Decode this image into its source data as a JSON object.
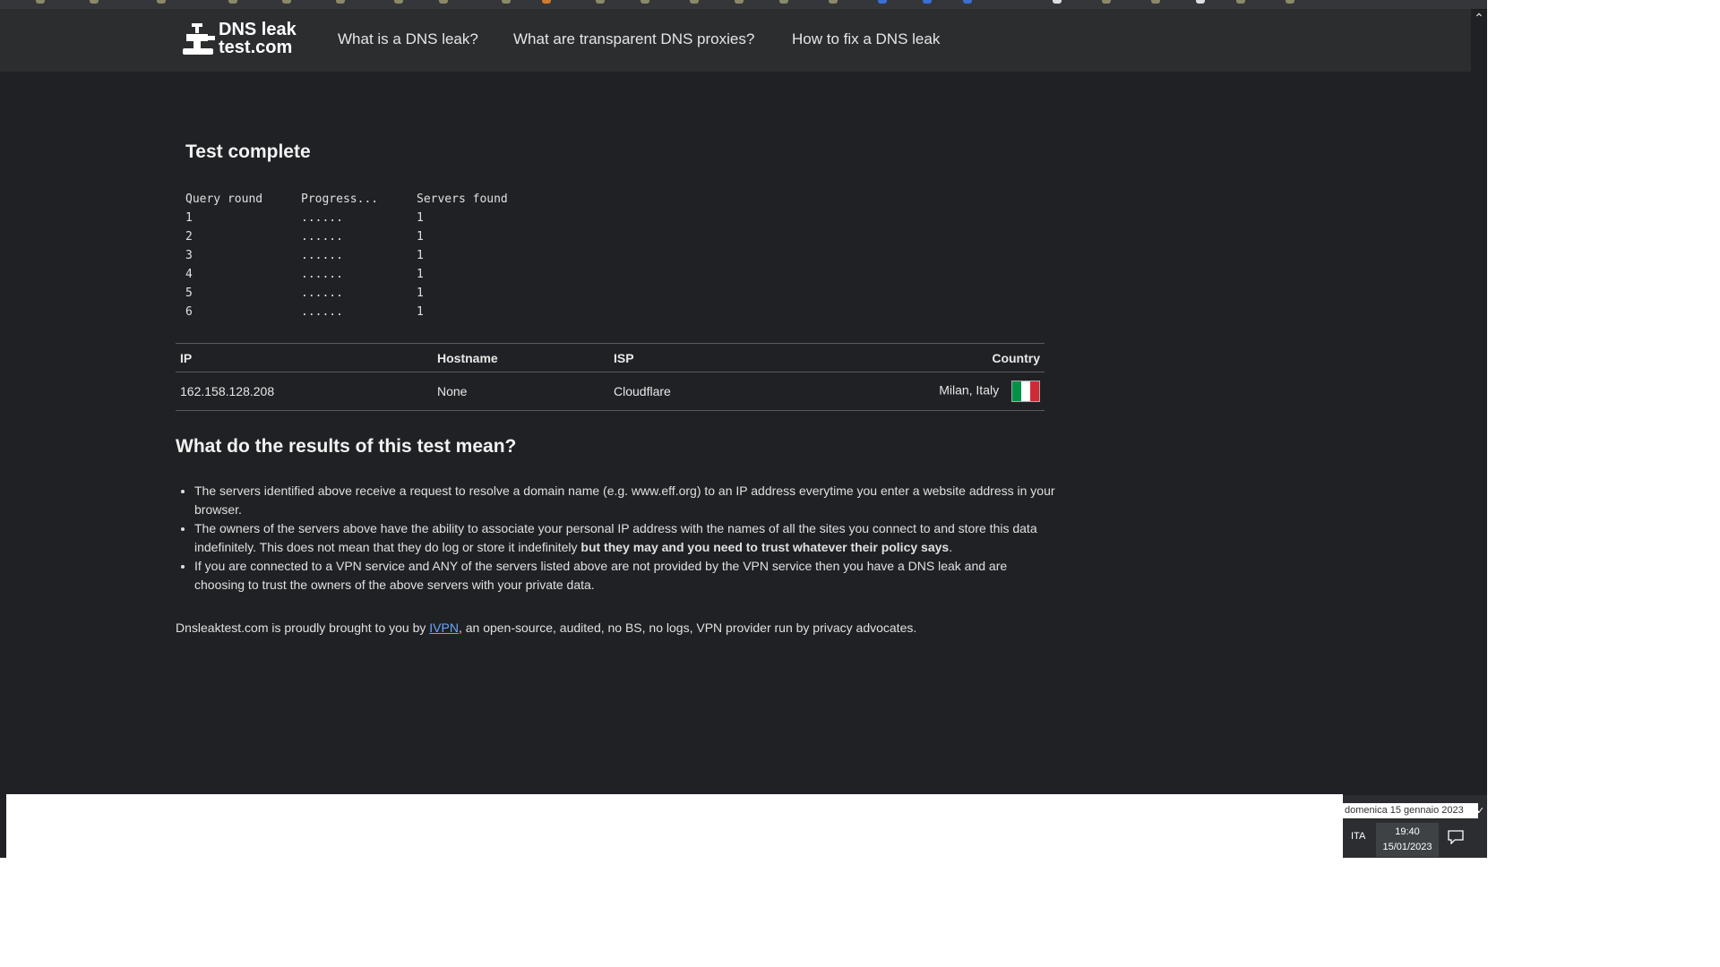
{
  "nav": {
    "logo_text_line1": "DNS leak",
    "logo_text_line2": "test.com",
    "links": [
      "What is a DNS leak?",
      "What are transparent DNS proxies?",
      "How to fix a DNS leak"
    ]
  },
  "test": {
    "title": "Test complete",
    "headers": [
      "Query round",
      "Progress...",
      "Servers found"
    ],
    "rounds": [
      {
        "round": "1",
        "progress": "......",
        "found": "1"
      },
      {
        "round": "2",
        "progress": "......",
        "found": "1"
      },
      {
        "round": "3",
        "progress": "......",
        "found": "1"
      },
      {
        "round": "4",
        "progress": "......",
        "found": "1"
      },
      {
        "round": "5",
        "progress": "......",
        "found": "1"
      },
      {
        "round": "6",
        "progress": "......",
        "found": "1"
      }
    ]
  },
  "results": {
    "headers": {
      "ip": "IP",
      "hostname": "Hostname",
      "isp": "ISP",
      "country": "Country"
    },
    "row": {
      "ip": "162.158.128.208",
      "hostname": "None",
      "isp": "Cloudflare",
      "country": "Milan, Italy",
      "flag_colors": [
        "#009246",
        "#ffffff",
        "#ce2b37"
      ]
    }
  },
  "explain": {
    "title": "What do the results of this test mean?",
    "bullet1": "The servers identified above receive a request to resolve a domain name (e.g. www.eff.org) to an IP address everytime you enter a website address in your browser.",
    "bullet2_pre": "The owners of the servers above have the ability to associate your personal IP address with the names of all the sites you connect to and store this data indefinitely. This does not mean that they do log or store it indefinitely ",
    "bullet2_bold": "but they may and you need to trust whatever their policy says",
    "bullet2_post": ".",
    "bullet3": "If you are connected to a VPN service and ANY of the servers listed above are not provided by the VPN service then you have a DNS leak and are choosing to trust the owners of the above servers with your private data."
  },
  "footer": {
    "pre": "Dnsleaktest.com is proudly brought to you by ",
    "link": "IVPN",
    "post": ", an open-source, audited, no BS, no logs, VPN provider run by privacy advocates."
  },
  "taskbar": {
    "date_tooltip": "domenica 15 gennaio 2023",
    "lang": "ITA",
    "time": "19:40",
    "date": "15/01/2023"
  },
  "colors": {
    "page_bg": "#202124",
    "navbar_bg": "#2b2d2f",
    "link": "#6aa5ff"
  }
}
